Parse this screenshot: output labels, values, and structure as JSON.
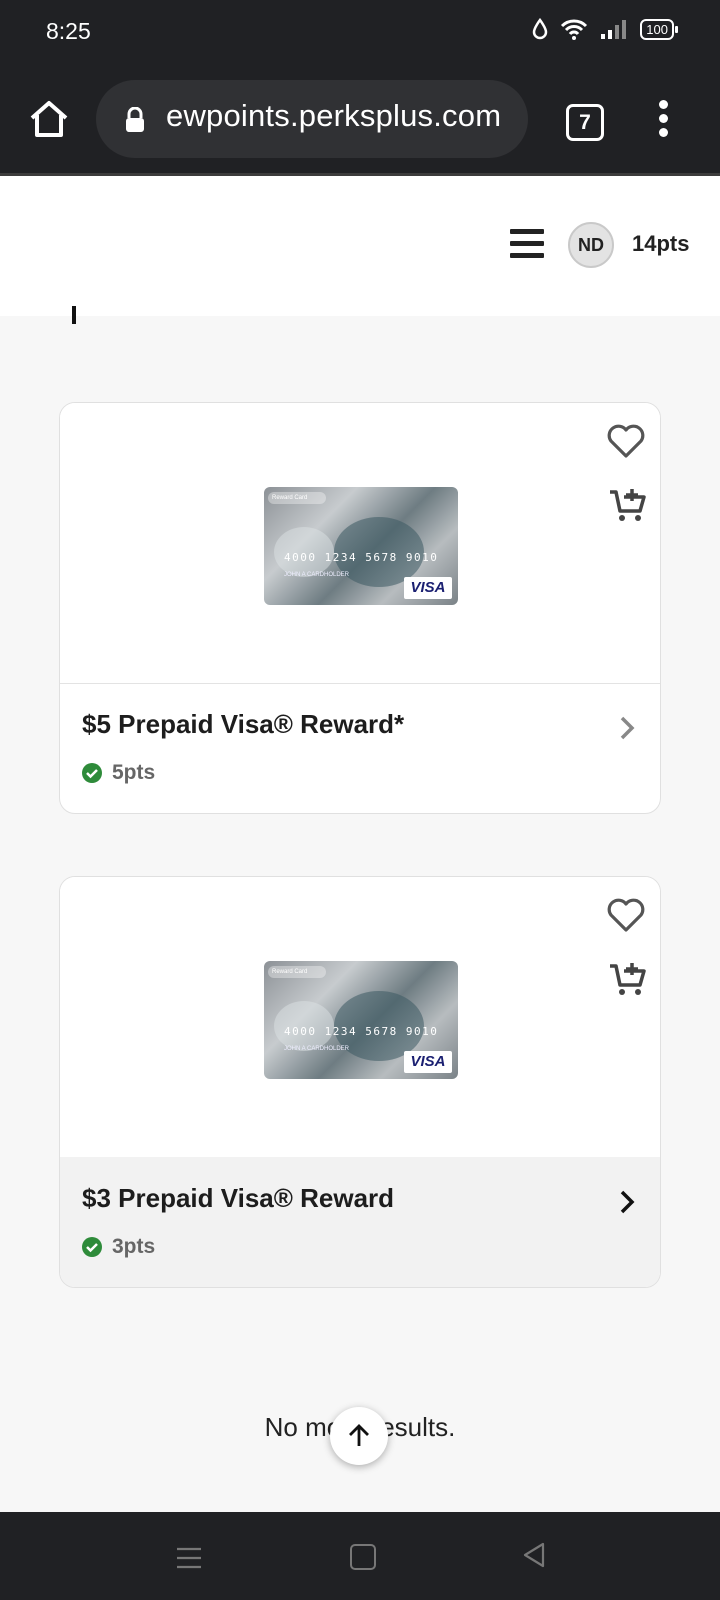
{
  "status_bar": {
    "time": "8:25",
    "battery": "100"
  },
  "browser": {
    "url": "ewpoints.perksplus.com",
    "tab_count": "7"
  },
  "header": {
    "avatar_initials": "ND",
    "points": "14pts"
  },
  "products": [
    {
      "title": "$5 Prepaid Visa® Reward*",
      "points": "5pts"
    },
    {
      "title": "$3 Prepaid Visa® Reward",
      "points": "3pts"
    }
  ],
  "card_art": {
    "tag": "Reward Card",
    "number": "4000 1234 5678 9010",
    "holder": "JOHN A CARDHOLDER",
    "brand": "VISA"
  },
  "footer": {
    "no_more_results": "No more results."
  },
  "colors": {
    "check_green": "#2e8b3a",
    "dark_bar": "#202124"
  }
}
